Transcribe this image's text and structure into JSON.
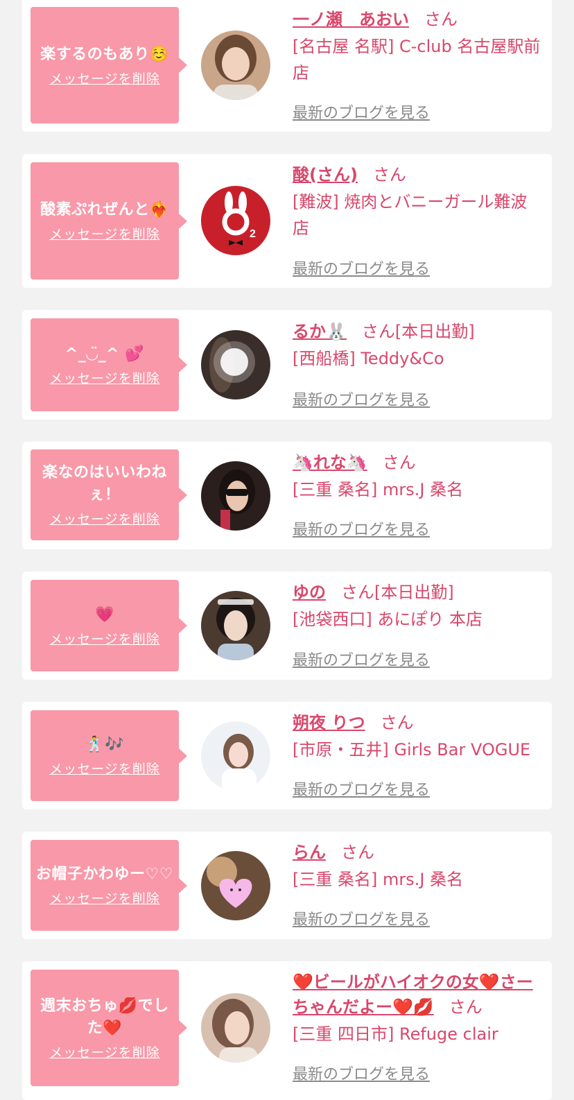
{
  "colors": {
    "page_bg": "#f2f2f2",
    "card_bg": "#ffffff",
    "bubble": "#f998a8",
    "accent": "#d9476b",
    "link_grey": "#8a8a8a"
  },
  "items": [
    {
      "message": "楽するのもあり☺️",
      "delete_label": "メッセージを削除",
      "name": "一ノ瀬　あおい",
      "san": "さん",
      "status": "",
      "store": "[名古屋 名駅] C-club 名古屋駅前店",
      "blog_label": "最新のブログを見る",
      "avatar_icon": "portrait-photo"
    },
    {
      "message": "酸素ぷれぜんと❤️‍🔥",
      "delete_label": "メッセージを削除",
      "name": "酸(さん)",
      "san": "さん",
      "status": "",
      "store": "[難波] 焼肉とバニーガール難波店",
      "blog_label": "最新のブログを見る",
      "avatar_icon": "o2-bunny-logo"
    },
    {
      "message": "^_◡̈_^ 💕",
      "delete_label": "メッセージを削除",
      "name": "るか🐰",
      "san": "さん",
      "status": "[本日出勤]",
      "store": "[西船橋] Teddy&Co",
      "blog_label": "最新のブログを見る",
      "avatar_icon": "portrait-photo"
    },
    {
      "message": "楽なのはいいわねぇ！",
      "delete_label": "メッセージを削除",
      "name": "🦄れな🦄",
      "san": "さん",
      "status": "",
      "store": "[三重 桑名] mrs.J 桑名",
      "blog_label": "最新のブログを見る",
      "avatar_icon": "portrait-photo"
    },
    {
      "message": "💗",
      "delete_label": "メッセージを削除",
      "name": "ゆの",
      "san": "さん",
      "status": "[本日出勤]",
      "store": "[池袋西口] あにぽり 本店",
      "blog_label": "最新のブログを見る",
      "avatar_icon": "portrait-photo"
    },
    {
      "message": "🕺🎶",
      "delete_label": "メッセージを削除",
      "name": "朔夜 りつ",
      "san": "さん",
      "status": "",
      "store": "[市原・五井] Girls Bar VOGUE",
      "blog_label": "最新のブログを見る",
      "avatar_icon": "portrait-photo"
    },
    {
      "message": "お帽子かわゆー♡♡",
      "delete_label": "メッセージを削除",
      "name": "らん",
      "san": "さん",
      "status": "",
      "store": "[三重 桑名] mrs.J 桑名",
      "blog_label": "最新のブログを見る",
      "avatar_icon": "heart-face-photo"
    },
    {
      "message": "週末おちゅ💋でした❤️",
      "delete_label": "メッセージを削除",
      "name": "❤️ビールがハイオクの女❤️さーちゃんだよー❤️💋",
      "san": "さん",
      "status": "",
      "store": "[三重 四日市] Refuge clair",
      "blog_label": "最新のブログを見る",
      "avatar_icon": "portrait-photo"
    }
  ]
}
